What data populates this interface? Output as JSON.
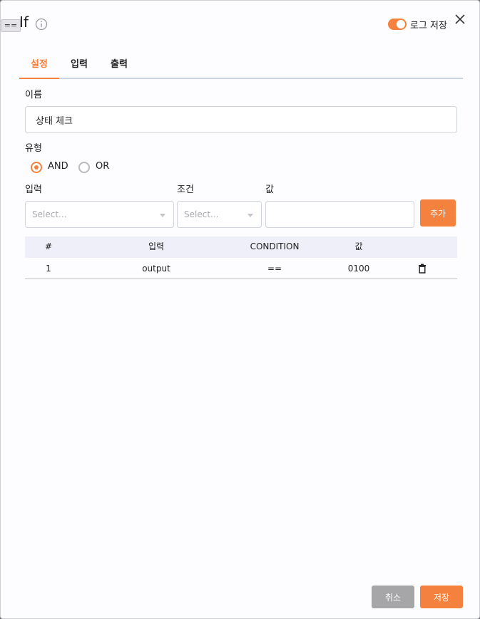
{
  "header": {
    "node_tag": "==",
    "title": "If",
    "log_label": "로그 저장",
    "log_enabled": true
  },
  "tabs": [
    {
      "label": "설정",
      "active": true
    },
    {
      "label": "입력",
      "active": false
    },
    {
      "label": "출력",
      "active": false
    }
  ],
  "settings": {
    "name_label": "이름",
    "name_value": "상태 체크",
    "type_label": "유형",
    "type_options": [
      {
        "label": "AND",
        "checked": true
      },
      {
        "label": "OR",
        "checked": false
      }
    ],
    "input_label": "입력",
    "condition_label": "조건",
    "value_label": "값",
    "input_placeholder": "Select...",
    "condition_placeholder": "Select...",
    "value_input": "",
    "add_button": "추가"
  },
  "table": {
    "headers": [
      "#",
      "입력",
      "CONDITION",
      "값"
    ],
    "rows": [
      {
        "index": "1",
        "input": "output",
        "condition": "==",
        "value": "0100"
      }
    ]
  },
  "footer": {
    "cancel_label": "취소",
    "save_label": "저장"
  },
  "colors": {
    "accent": "#f5813f",
    "cancel": "#a6a6a8"
  },
  "icons": [
    "info-icon",
    "close-icon",
    "trash-icon",
    "chevron-down-icon"
  ]
}
